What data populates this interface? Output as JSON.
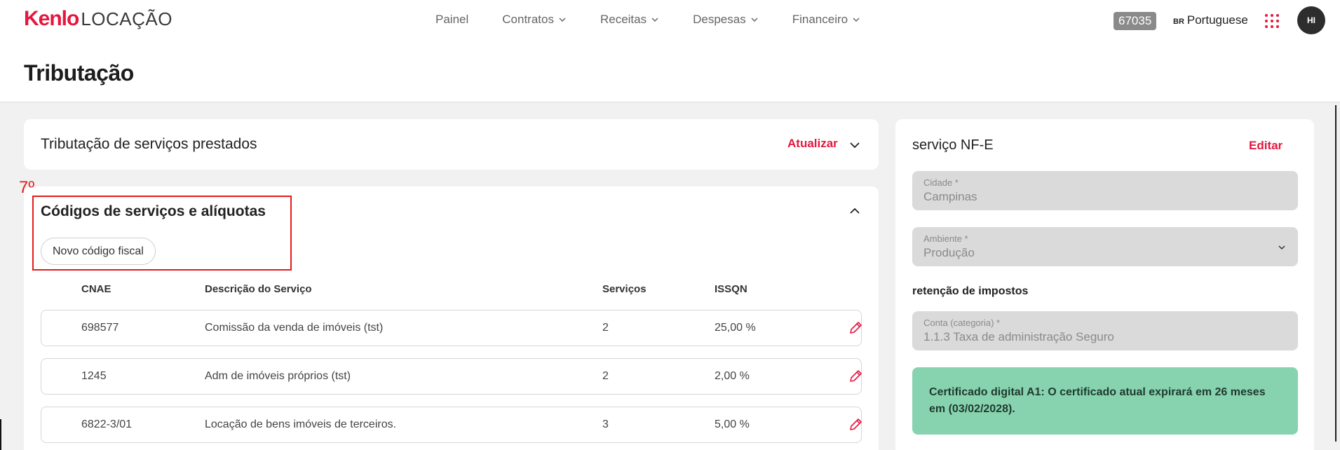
{
  "app": {
    "logo_mark": "Kenlo",
    "logo_text": "LOCAÇÃO"
  },
  "nav": {
    "items": [
      {
        "label": "Painel",
        "dropdown": false
      },
      {
        "label": "Contratos",
        "dropdown": true
      },
      {
        "label": "Receitas",
        "dropdown": true
      },
      {
        "label": "Despesas",
        "dropdown": true
      },
      {
        "label": "Financeiro",
        "dropdown": true
      }
    ]
  },
  "header": {
    "account_id": "67035",
    "lang_flag": "BR",
    "lang_label": "Portuguese",
    "avatar_initials": "HI"
  },
  "page": {
    "title": "Tributação"
  },
  "tax_card": {
    "title": "Tributação de serviços prestados",
    "update_label": "Atualizar"
  },
  "codes_card": {
    "title": "Códigos de serviços e alíquotas",
    "new_button": "Novo código fiscal",
    "columns": {
      "cnae": "CNAE",
      "description": "Descrição do Serviço",
      "services": "Serviços",
      "issqn": "ISSQN"
    },
    "rows": [
      {
        "cnae": "698577",
        "description": "Comissão da venda de imóveis (tst)",
        "services": "2",
        "issqn": "25,00 %"
      },
      {
        "cnae": "1245",
        "description": "Adm de imóveis próprios (tst)",
        "services": "2",
        "issqn": "2,00 %"
      },
      {
        "cnae": "6822-3/01",
        "description": "Locação de bens imóveis de terceiros.",
        "services": "3",
        "issqn": "5,00 %"
      }
    ]
  },
  "annotation": {
    "label": "7º",
    "color": "#e31b1b"
  },
  "side_card": {
    "title": "serviço NF-E",
    "edit_label": "Editar",
    "city": {
      "label": "Cidade *",
      "value": "Campinas"
    },
    "environment": {
      "label": "Ambiente *",
      "value": "Produção"
    },
    "retention_title": "retenção de impostos",
    "account": {
      "label": "Conta (categoria) *",
      "value": "1.1.3 Taxa de administração Seguro"
    },
    "certificate": "Certificado digital A1: O certificado atual expirará em 26 meses em (03/02/2028)."
  },
  "colors": {
    "brand": "#e5173f",
    "success_bg": "#87d3b0",
    "field_bg": "#dadada"
  }
}
